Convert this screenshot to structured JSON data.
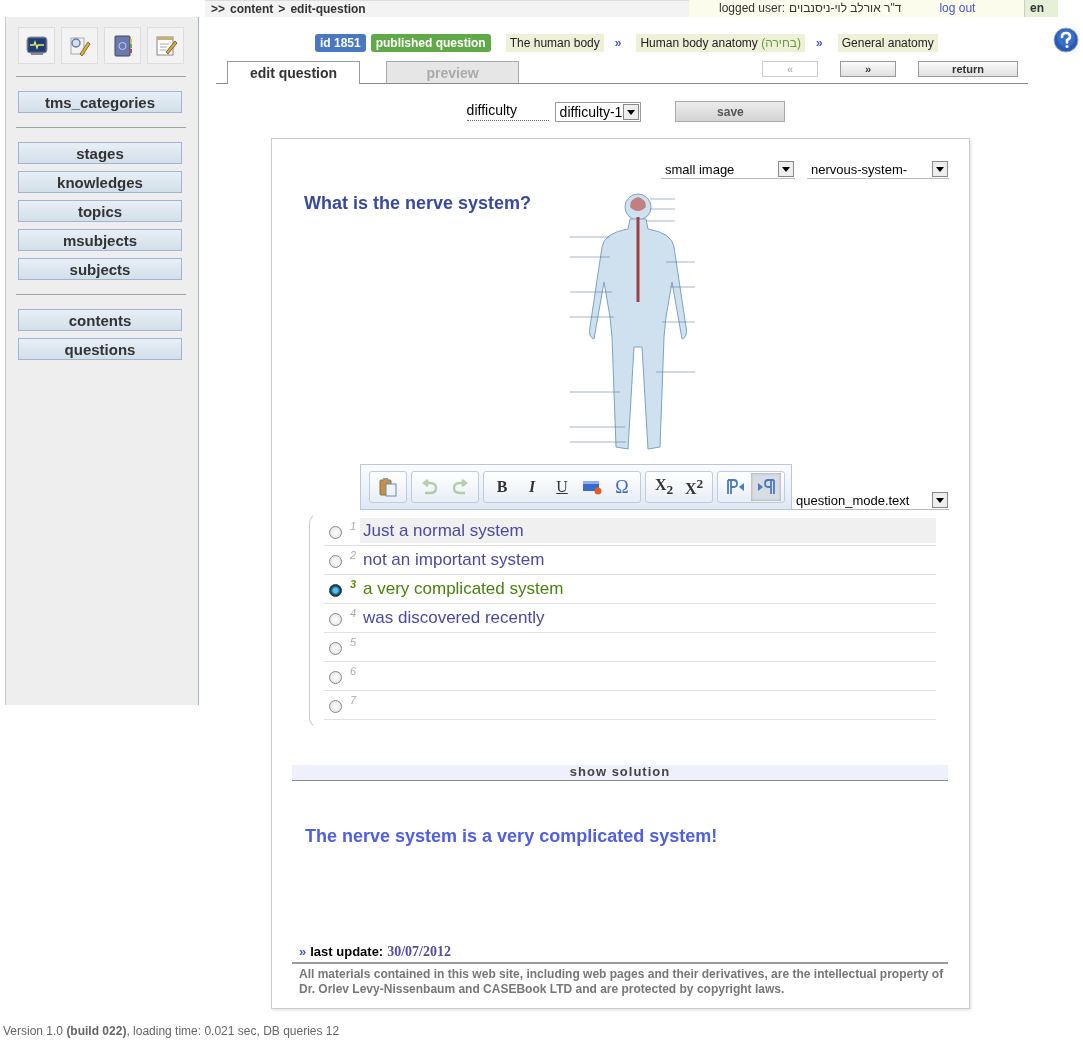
{
  "topbar": {
    "breadcrumb": {
      "lead": ">>",
      "items": [
        "content",
        "edit-question"
      ],
      "separator": ">"
    },
    "user_label": "logged user:",
    "user_name": "ד\"ר אורלב לוי-ניסנבוים",
    "logout": "log out",
    "language": "en"
  },
  "sidebar": {
    "groups": [
      [
        "tms_categories"
      ],
      [
        "stages",
        "knowledges",
        "topics",
        "msubjects",
        "subjects"
      ],
      [
        "contents",
        "questions"
      ]
    ]
  },
  "header": {
    "id_badge": "id 1851",
    "status": "published question",
    "path": [
      {
        "text": "The human body"
      },
      {
        "separator": "»",
        "text": "Human body anatomy",
        "note": "(בחירה)"
      },
      {
        "separator": "»",
        "text": "General anatomy"
      }
    ]
  },
  "tabs": [
    {
      "label": "edit question",
      "selected": true
    },
    {
      "label": "preview",
      "selected": false
    }
  ],
  "nav": [
    {
      "label": "«",
      "disabled": true
    },
    {
      "label": "»",
      "disabled": false
    },
    {
      "label": "return",
      "disabled": false
    }
  ],
  "difficulty": {
    "label": "difficulty",
    "value": "difficulty-1"
  },
  "save": "save",
  "media": {
    "size": "small image",
    "file": "nervous-system-"
  },
  "question": "What is the nerve system?",
  "toolbar": [
    [
      {
        "kind": "paste",
        "disabled": false,
        "pressed": false
      }
    ],
    [
      {
        "kind": "undo",
        "disabled": true,
        "pressed": false
      },
      {
        "kind": "redo",
        "disabled": true,
        "pressed": false
      }
    ],
    [
      {
        "kind": "bold",
        "label": "B",
        "disabled": false,
        "pressed": false
      },
      {
        "kind": "italic",
        "label": "I",
        "disabled": false,
        "pressed": false
      },
      {
        "kind": "underline",
        "label": "U",
        "disabled": false,
        "pressed": false
      },
      {
        "kind": "html",
        "disabled": false,
        "pressed": false
      },
      {
        "kind": "symbol",
        "label": "Ω",
        "disabled": false,
        "pressed": false
      }
    ],
    [
      {
        "kind": "subscript",
        "label": "X$_{2}$",
        "disabled": false,
        "pressed": false
      },
      {
        "kind": "superscript",
        "label": "X$^{2}$",
        "disabled": false,
        "pressed": false
      }
    ],
    [
      {
        "kind": "ltr",
        "disabled": false,
        "pressed": false
      },
      {
        "kind": "rtl",
        "disabled": false,
        "pressed": true
      }
    ]
  ],
  "mode": "question_mode.text",
  "answers": [
    {
      "number": "1",
      "text": "Just a normal system",
      "selected": false,
      "editing": true
    },
    {
      "number": "2",
      "text": "not an important system",
      "selected": false,
      "editing": false
    },
    {
      "number": "3",
      "text": "a very complicated system",
      "selected": true,
      "editing": false
    },
    {
      "number": "4",
      "text": "was discovered recently",
      "selected": false,
      "editing": false
    },
    {
      "number": "5",
      "selected": false,
      "editing": false
    },
    {
      "number": "6",
      "selected": false,
      "editing": false
    },
    {
      "number": "7",
      "selected": false,
      "editing": false
    }
  ],
  "solution_toggle": "show solution",
  "solution": "The nerve system is a very complicated system!",
  "last_update": {
    "marker": "»",
    "label": "last update:",
    "date": "30/07/2012"
  },
  "copyright": "All materials contained in this web site, including web pages and their derivatives, are the intellectual property of Dr. Orlev Levy-Nissenbaum and CASEBook LTD and are protected by copyright laws.",
  "footer": "Version 1.0 **(build 022)**, loading time: 0.021 sec, DB queries 12"
}
